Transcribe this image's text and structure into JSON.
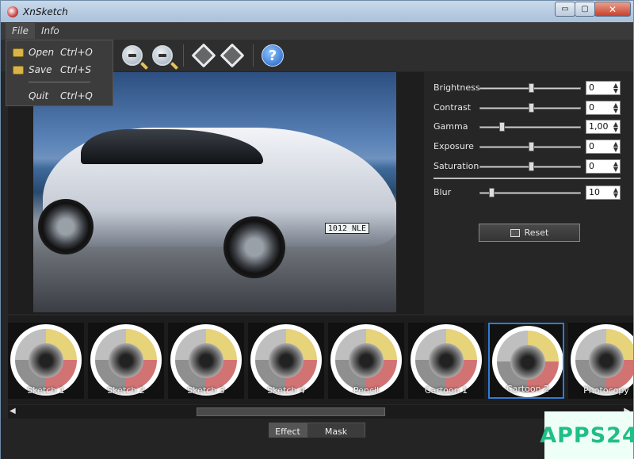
{
  "window": {
    "title": "XnSketch",
    "controls": {
      "minimize": "▭",
      "maximize": "▢",
      "close": "✕"
    }
  },
  "menubar": {
    "items": [
      "File",
      "Info"
    ]
  },
  "file_menu": {
    "items": [
      {
        "label": "Open",
        "shortcut": "Ctrl+O",
        "icon": "folder-open-icon"
      },
      {
        "label": "Save",
        "shortcut": "Ctrl+S",
        "icon": "save-folder-icon"
      },
      {
        "label": "Quit",
        "shortcut": "Ctrl+Q"
      }
    ]
  },
  "toolbar": {
    "tools": [
      "zoom-in-icon",
      "zoom-out-icon",
      "rotate-left-icon",
      "rotate-right-icon",
      "help-icon"
    ],
    "help_label": "?"
  },
  "preview": {
    "plate_text": "1012 NLE"
  },
  "adjustments": {
    "sliders": [
      {
        "label": "Brightness",
        "value": "0",
        "level": 0.5
      },
      {
        "label": "Contrast",
        "value": "0",
        "level": 0.5
      },
      {
        "label": "Gamma",
        "value": "1,00",
        "level": 0.2
      },
      {
        "label": "Exposure",
        "value": "0",
        "level": 0.5
      },
      {
        "label": "Saturation",
        "value": "0",
        "level": 0.5
      },
      {
        "label": "Blur",
        "value": "10",
        "level": 0.1
      }
    ],
    "reset_label": "Reset"
  },
  "effects": {
    "items": [
      "Sketch 1",
      "Sketch 2",
      "Sketch 3",
      "Sketch 4",
      "Pencil",
      "Cartoon 1",
      "Cartoon 2",
      "Photocopy"
    ],
    "selected": "Cartoon 2"
  },
  "scrollbar": {
    "left_arrow": "◀",
    "right_arrow": "▶"
  },
  "tabs": [
    "Effect",
    "Mask"
  ],
  "active_tab": "Effect",
  "watermark": {
    "text": "APPS24"
  },
  "colors": {
    "accent": "#2d7cd6",
    "watermark": "#1fbf85"
  }
}
